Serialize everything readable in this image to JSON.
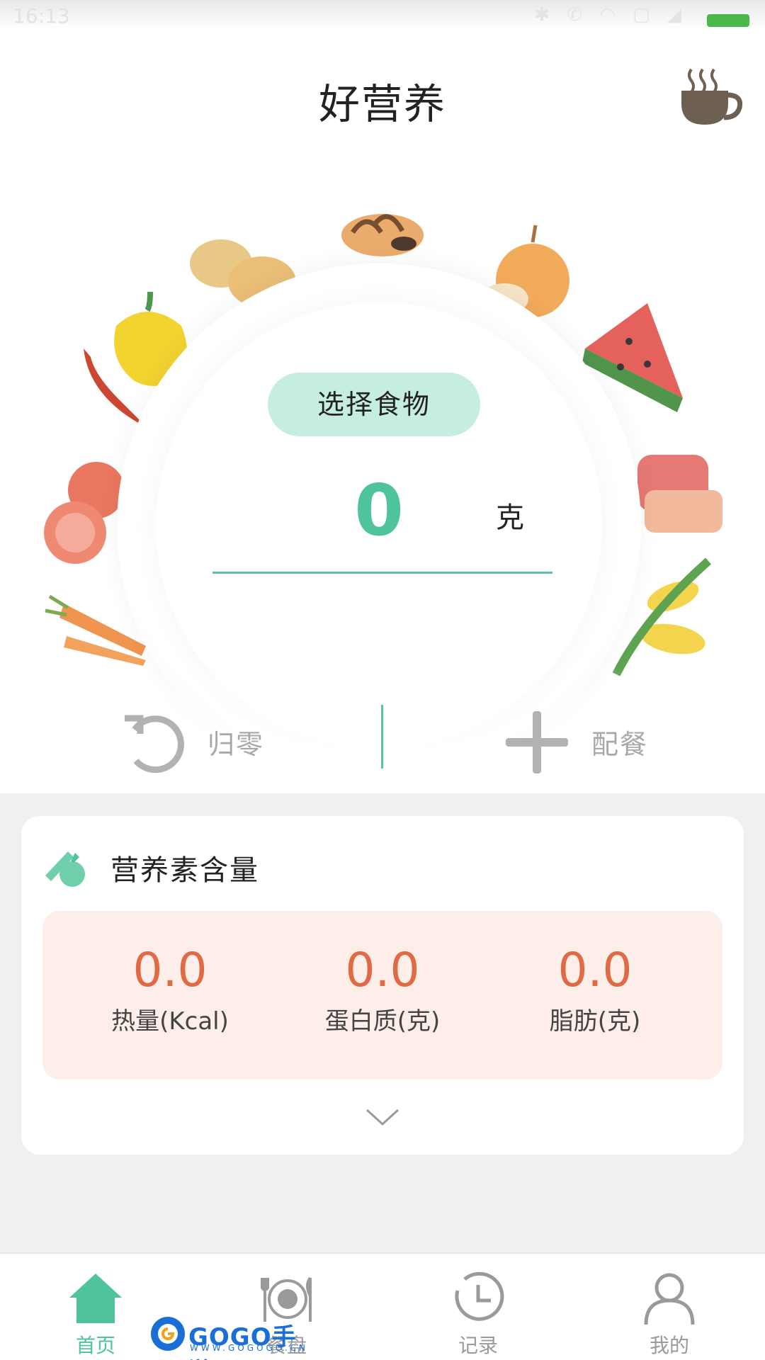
{
  "status_bar": {
    "time": "16:13"
  },
  "header": {
    "title": "好营养"
  },
  "scale": {
    "choose_food_label": "选择食物",
    "weight_value": "0",
    "weight_unit": "克"
  },
  "actions": {
    "zero_label": "归零",
    "meal_label": "配餐"
  },
  "nutrition": {
    "title": "营养素含量",
    "items": [
      {
        "value": "0.0",
        "label": "热量(Kcal)"
      },
      {
        "value": "0.0",
        "label": "蛋白质(克)"
      },
      {
        "value": "0.0",
        "label": "脂肪(克)"
      }
    ]
  },
  "nav": {
    "items": [
      {
        "label": "首页",
        "icon": "home-icon",
        "active": true
      },
      {
        "label": "餐盘",
        "icon": "plate-icon",
        "active": false
      },
      {
        "label": "记录",
        "icon": "clock-icon",
        "active": false
      },
      {
        "label": "我的",
        "icon": "user-icon",
        "active": false
      }
    ]
  },
  "watermark": {
    "text": "GOGO手游网",
    "sub": "WWW.GOGOGO.CN"
  },
  "colors": {
    "accent": "#4fc49a",
    "accent_light": "#c5eee0",
    "nutrient_value": "#e06a44",
    "nutrient_panel": "#fdeee9"
  }
}
